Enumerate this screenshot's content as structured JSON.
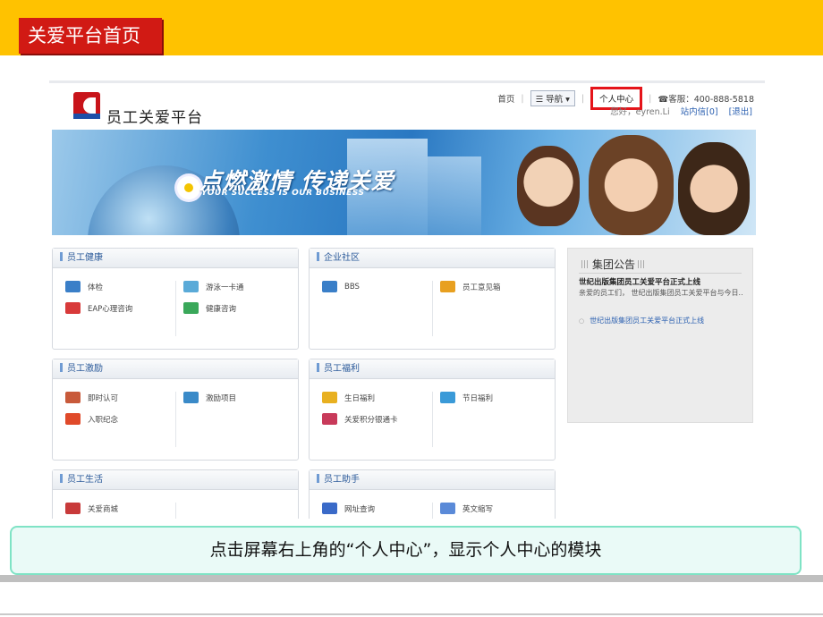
{
  "slide": {
    "title": "关爱平台首页",
    "caption": "点击屏幕右上角的“个人中心”，显示个人中心的模块"
  },
  "site": {
    "name": "员工关爱平台",
    "topnav": {
      "home": "首页",
      "nav": "导航",
      "personal_center": "个人中心",
      "service": "客服：400-888-5818"
    },
    "userline": {
      "greeting": "您好，eyren.Li",
      "inbox": "站内信[0]",
      "logout": "[退出]"
    }
  },
  "banner": {
    "slogan": "点燃激情 传递关爱",
    "slogan_en": "YOUR SUCCESS IS OUR BUSINESS"
  },
  "panels": [
    {
      "title": "员工健康",
      "items": [
        {
          "label": "体检",
          "color": "#3a7fc8"
        },
        {
          "label": "游泳一卡通",
          "color": "#5aaad8"
        },
        {
          "label": "EAP心理咨询",
          "color": "#d83a3a"
        },
        {
          "label": "健康咨询",
          "color": "#3aa85a"
        }
      ]
    },
    {
      "title": "企业社区",
      "items": [
        {
          "label": "BBS",
          "color": "#3a7fc8"
        },
        {
          "label": "员工意见箱",
          "color": "#e8a020"
        }
      ]
    },
    {
      "title": "员工激励",
      "items": [
        {
          "label": "即时认可",
          "color": "#c85a3a"
        },
        {
          "label": "激励项目",
          "color": "#3a8ac8"
        },
        {
          "label": "入职纪念",
          "color": "#e04a2a"
        }
      ]
    },
    {
      "title": "员工福利",
      "items": [
        {
          "label": "生日福利",
          "color": "#e8b020"
        },
        {
          "label": "节日福利",
          "color": "#3a9ad8"
        },
        {
          "label": "关爱积分银通卡",
          "color": "#c83a5a"
        }
      ]
    },
    {
      "title": "员工生活",
      "items": [
        {
          "label": "关爱商城",
          "color": "#c83a3a"
        }
      ]
    },
    {
      "title": "员工助手",
      "items": [
        {
          "label": "网址查询",
          "color": "#3a6ac8"
        },
        {
          "label": "英文缩写",
          "color": "#5a8ad8"
        }
      ]
    }
  ],
  "notice": {
    "title": "集团公告",
    "headline": "世纪出版集团员工关爱平台正式上线",
    "text": "亲爱的员工们， 世纪出版集团员工关爱平台与今日..",
    "link": "世纪出版集团员工关爱平台正式上线"
  }
}
